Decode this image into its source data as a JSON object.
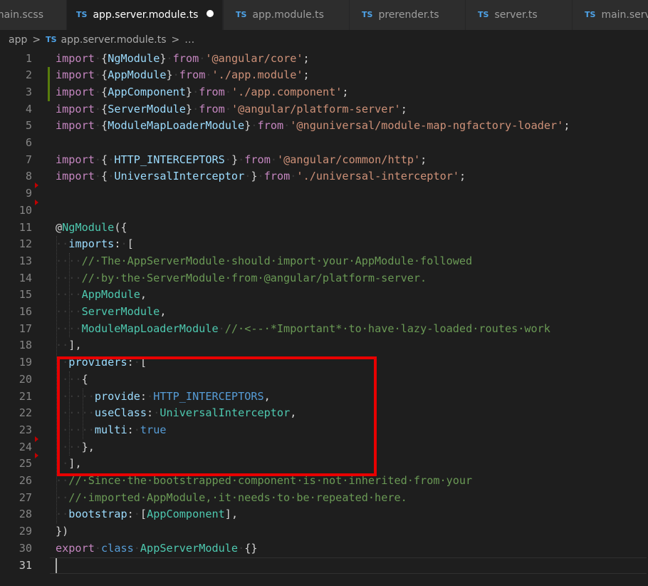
{
  "tabs": [
    {
      "label": "main.scss",
      "icon": "none",
      "active": false
    },
    {
      "label": "app.server.module.ts",
      "icon": "ts-file-icon",
      "active": true,
      "dirty": true
    },
    {
      "label": "app.module.ts",
      "icon": "ts-file-icon",
      "active": false
    },
    {
      "label": "prerender.ts",
      "icon": "ts-file-icon",
      "active": false
    },
    {
      "label": "server.ts",
      "icon": "ts-file-icon",
      "active": false
    },
    {
      "label": "main.server.ts",
      "icon": "ts-file-icon",
      "active": false
    }
  ],
  "ts_badge": "TS",
  "breadcrumb": {
    "folder": "app",
    "separator": ">",
    "file": "app.server.module.ts",
    "trail": "…"
  },
  "colors": {
    "keyword": "#c586c0",
    "storage": "#569cd6",
    "string": "#ce9178",
    "identifier": "#9cdcfe",
    "type": "#4ec9b0",
    "comment": "#6a9955",
    "highlight_box": "#e80000"
  },
  "editor": {
    "cursor_line": 31,
    "modified_lines": [
      2,
      3
    ],
    "fold_markers": [
      9,
      10,
      24,
      25
    ],
    "highlight_lines": [
      19,
      25
    ],
    "lines": [
      {
        "n": "1",
        "tokens": [
          [
            "kw",
            "import"
          ],
          [
            "ws",
            "·"
          ],
          [
            "pn",
            "{"
          ],
          [
            "id",
            "NgModule"
          ],
          [
            "pn",
            "}"
          ],
          [
            "ws",
            "·"
          ],
          [
            "kw",
            "from"
          ],
          [
            "ws",
            "·"
          ],
          [
            "str",
            "'@angular/core'"
          ],
          [
            "pn",
            ";"
          ]
        ]
      },
      {
        "n": "2",
        "tokens": [
          [
            "kw",
            "import"
          ],
          [
            "ws",
            "·"
          ],
          [
            "pn",
            "{"
          ],
          [
            "id",
            "AppModule"
          ],
          [
            "pn",
            "}"
          ],
          [
            "ws",
            "·"
          ],
          [
            "kw",
            "from"
          ],
          [
            "ws",
            "·"
          ],
          [
            "str",
            "'./app.module'"
          ],
          [
            "pn",
            ";"
          ]
        ]
      },
      {
        "n": "3",
        "tokens": [
          [
            "kw",
            "import"
          ],
          [
            "ws",
            "·"
          ],
          [
            "pn",
            "{"
          ],
          [
            "id",
            "AppComponent"
          ],
          [
            "pn",
            "}"
          ],
          [
            "ws",
            "·"
          ],
          [
            "kw",
            "from"
          ],
          [
            "ws",
            "·"
          ],
          [
            "str",
            "'./app.component'"
          ],
          [
            "pn",
            ";"
          ]
        ]
      },
      {
        "n": "4",
        "tokens": [
          [
            "kw",
            "import"
          ],
          [
            "ws",
            "·"
          ],
          [
            "pn",
            "{"
          ],
          [
            "id",
            "ServerModule"
          ],
          [
            "pn",
            "}"
          ],
          [
            "ws",
            "·"
          ],
          [
            "kw",
            "from"
          ],
          [
            "ws",
            "·"
          ],
          [
            "str",
            "'@angular/platform-server'"
          ],
          [
            "pn",
            ";"
          ]
        ]
      },
      {
        "n": "5",
        "tokens": [
          [
            "kw",
            "import"
          ],
          [
            "ws",
            "·"
          ],
          [
            "pn",
            "{"
          ],
          [
            "id",
            "ModuleMapLoaderModule"
          ],
          [
            "pn",
            "}"
          ],
          [
            "ws",
            "·"
          ],
          [
            "kw",
            "from"
          ],
          [
            "ws",
            "·"
          ],
          [
            "str",
            "'@nguniversal/module-map-ngfactory-loader'"
          ],
          [
            "pn",
            ";"
          ]
        ]
      },
      {
        "n": "6",
        "tokens": []
      },
      {
        "n": "7",
        "tokens": [
          [
            "kw",
            "import"
          ],
          [
            "ws",
            "·"
          ],
          [
            "pn",
            "{"
          ],
          [
            "ws",
            "·"
          ],
          [
            "id",
            "HTTP_INTERCEPTORS"
          ],
          [
            "ws",
            "·"
          ],
          [
            "pn",
            "}"
          ],
          [
            "ws",
            "·"
          ],
          [
            "kw",
            "from"
          ],
          [
            "ws",
            "·"
          ],
          [
            "str",
            "'@angular/common/http'"
          ],
          [
            "pn",
            ";"
          ]
        ]
      },
      {
        "n": "8",
        "tokens": [
          [
            "kw",
            "import"
          ],
          [
            "ws",
            "·"
          ],
          [
            "pn",
            "{"
          ],
          [
            "ws",
            "·"
          ],
          [
            "id",
            "UniversalInterceptor"
          ],
          [
            "ws",
            "·"
          ],
          [
            "pn",
            "}"
          ],
          [
            "ws",
            "·"
          ],
          [
            "kw",
            "from"
          ],
          [
            "ws",
            "·"
          ],
          [
            "str",
            "'./universal-interceptor'"
          ],
          [
            "pn",
            ";"
          ]
        ]
      },
      {
        "n": "9",
        "tokens": []
      },
      {
        "n": "10",
        "tokens": []
      },
      {
        "n": "11",
        "tokens": [
          [
            "pn",
            "@"
          ],
          [
            "ty",
            "NgModule"
          ],
          [
            "pn",
            "({"
          ]
        ]
      },
      {
        "n": "12",
        "tokens": [
          [
            "ws",
            "··"
          ],
          [
            "id",
            "imports"
          ],
          [
            "pn",
            ":"
          ],
          [
            "ws",
            "·"
          ],
          [
            "pn",
            "["
          ]
        ]
      },
      {
        "n": "13",
        "tokens": [
          [
            "ws",
            "····"
          ],
          [
            "cm",
            "//·The·AppServerModule·should·import·your·AppModule·followed"
          ]
        ]
      },
      {
        "n": "14",
        "tokens": [
          [
            "ws",
            "····"
          ],
          [
            "cm",
            "//·by·the·ServerModule·from·@angular/platform-server."
          ]
        ]
      },
      {
        "n": "15",
        "tokens": [
          [
            "ws",
            "····"
          ],
          [
            "ty",
            "AppModule"
          ],
          [
            "pn",
            ","
          ]
        ]
      },
      {
        "n": "16",
        "tokens": [
          [
            "ws",
            "····"
          ],
          [
            "ty",
            "ServerModule"
          ],
          [
            "pn",
            ","
          ]
        ]
      },
      {
        "n": "17",
        "tokens": [
          [
            "ws",
            "····"
          ],
          [
            "ty",
            "ModuleMapLoaderModule"
          ],
          [
            "ws",
            "·"
          ],
          [
            "cm",
            "//·<--·*Important*·to·have·lazy-loaded·routes·work"
          ]
        ]
      },
      {
        "n": "18",
        "tokens": [
          [
            "ws",
            "··"
          ],
          [
            "pn",
            "],"
          ]
        ]
      },
      {
        "n": "19",
        "tokens": [
          [
            "ws",
            "··"
          ],
          [
            "id",
            "providers"
          ],
          [
            "pn",
            ":"
          ],
          [
            "ws",
            "·"
          ],
          [
            "pn",
            "["
          ]
        ]
      },
      {
        "n": "20",
        "tokens": [
          [
            "ws",
            "····"
          ],
          [
            "pn",
            "{"
          ]
        ]
      },
      {
        "n": "21",
        "tokens": [
          [
            "ws",
            "······"
          ],
          [
            "id",
            "provide"
          ],
          [
            "pn",
            ":"
          ],
          [
            "ws",
            "·"
          ],
          [
            "kw2",
            "HTTP_INTERCEPTORS"
          ],
          [
            "pn",
            ","
          ]
        ]
      },
      {
        "n": "22",
        "tokens": [
          [
            "ws",
            "······"
          ],
          [
            "id",
            "useClass"
          ],
          [
            "pn",
            ":"
          ],
          [
            "ws",
            "·"
          ],
          [
            "ty",
            "UniversalInterceptor"
          ],
          [
            "pn",
            ","
          ]
        ]
      },
      {
        "n": "23",
        "tokens": [
          [
            "ws",
            "······"
          ],
          [
            "id",
            "multi"
          ],
          [
            "pn",
            ":"
          ],
          [
            "ws",
            "·"
          ],
          [
            "kw2",
            "true"
          ]
        ]
      },
      {
        "n": "24",
        "tokens": [
          [
            "ws",
            "····"
          ],
          [
            "pn",
            "},"
          ]
        ]
      },
      {
        "n": "25",
        "tokens": [
          [
            "ws",
            "··"
          ],
          [
            "pn",
            "],"
          ]
        ]
      },
      {
        "n": "26",
        "tokens": [
          [
            "ws",
            "··"
          ],
          [
            "cm",
            "//·Since·the·bootstrapped·component·is·not·inherited·from·your"
          ]
        ]
      },
      {
        "n": "27",
        "tokens": [
          [
            "ws",
            "··"
          ],
          [
            "cm",
            "//·imported·AppModule,·it·needs·to·be·repeated·here."
          ]
        ]
      },
      {
        "n": "28",
        "tokens": [
          [
            "ws",
            "··"
          ],
          [
            "id",
            "bootstrap"
          ],
          [
            "pn",
            ":"
          ],
          [
            "ws",
            "·"
          ],
          [
            "pn",
            "["
          ],
          [
            "ty",
            "AppComponent"
          ],
          [
            "pn",
            "],"
          ]
        ]
      },
      {
        "n": "29",
        "tokens": [
          [
            "pn",
            "})"
          ]
        ]
      },
      {
        "n": "30",
        "tokens": [
          [
            "kw",
            "export"
          ],
          [
            "ws",
            "·"
          ],
          [
            "kw2",
            "class"
          ],
          [
            "ws",
            "·"
          ],
          [
            "ty",
            "AppServerModule"
          ],
          [
            "ws",
            "·"
          ],
          [
            "pn",
            "{}"
          ]
        ]
      },
      {
        "n": "31",
        "tokens": []
      }
    ]
  }
}
